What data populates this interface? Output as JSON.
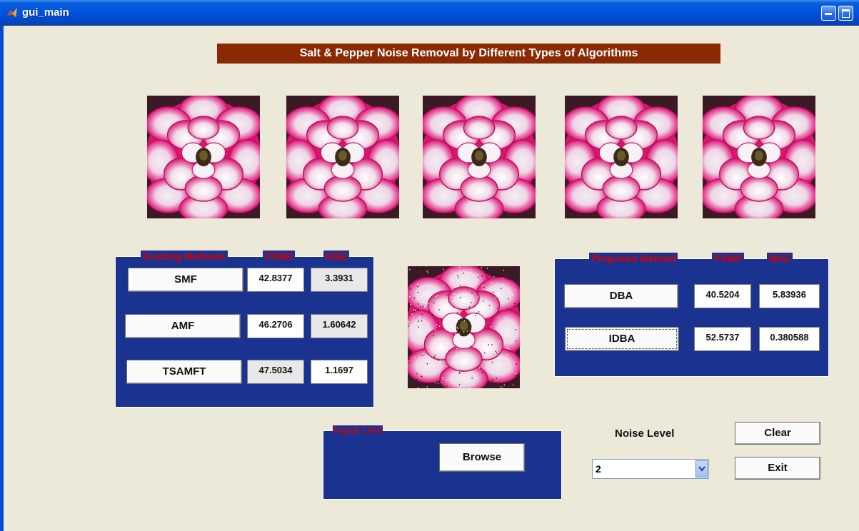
{
  "window": {
    "title": "gui_main"
  },
  "banner": {
    "text": "Salt & Pepper Noise Removal by Different Types of Algorithms"
  },
  "existing_panel": {
    "title": "Existing Methods",
    "psnr_header": "PSNR",
    "mse_header": "MSE",
    "rows": [
      {
        "button": "SMF",
        "psnr": "42.8377",
        "mse": "3.3931"
      },
      {
        "button": "AMF",
        "psnr": "46.2706",
        "mse": "1.60642"
      },
      {
        "button": "TSAMFT",
        "psnr": "47.5034",
        "mse": "1.1697"
      }
    ]
  },
  "proposed_panel": {
    "title": "Proposed Method",
    "psnr_header": "PSNR",
    "mse_header": "MSE",
    "rows": [
      {
        "button": "DBA",
        "psnr": "40.5204",
        "mse": "5.83936"
      },
      {
        "button": "IDBA",
        "psnr": "52.5737",
        "mse": "0.380588"
      }
    ]
  },
  "input_panel": {
    "title": "Input Unit",
    "browse_label": "Browse"
  },
  "controls": {
    "noise_label": "Noise Level",
    "noise_value": "2",
    "clear_label": "Clear",
    "exit_label": "Exit"
  },
  "colors": {
    "panel_bg": "#1a3390",
    "banner_bg": "#8a2a04",
    "panel_title": "#d40000",
    "window_bg": "#ece9d8"
  },
  "icons": [
    "matlab-icon",
    "minimize-icon",
    "maximize-icon",
    "dropdown-arrow-icon",
    "flower-image"
  ]
}
